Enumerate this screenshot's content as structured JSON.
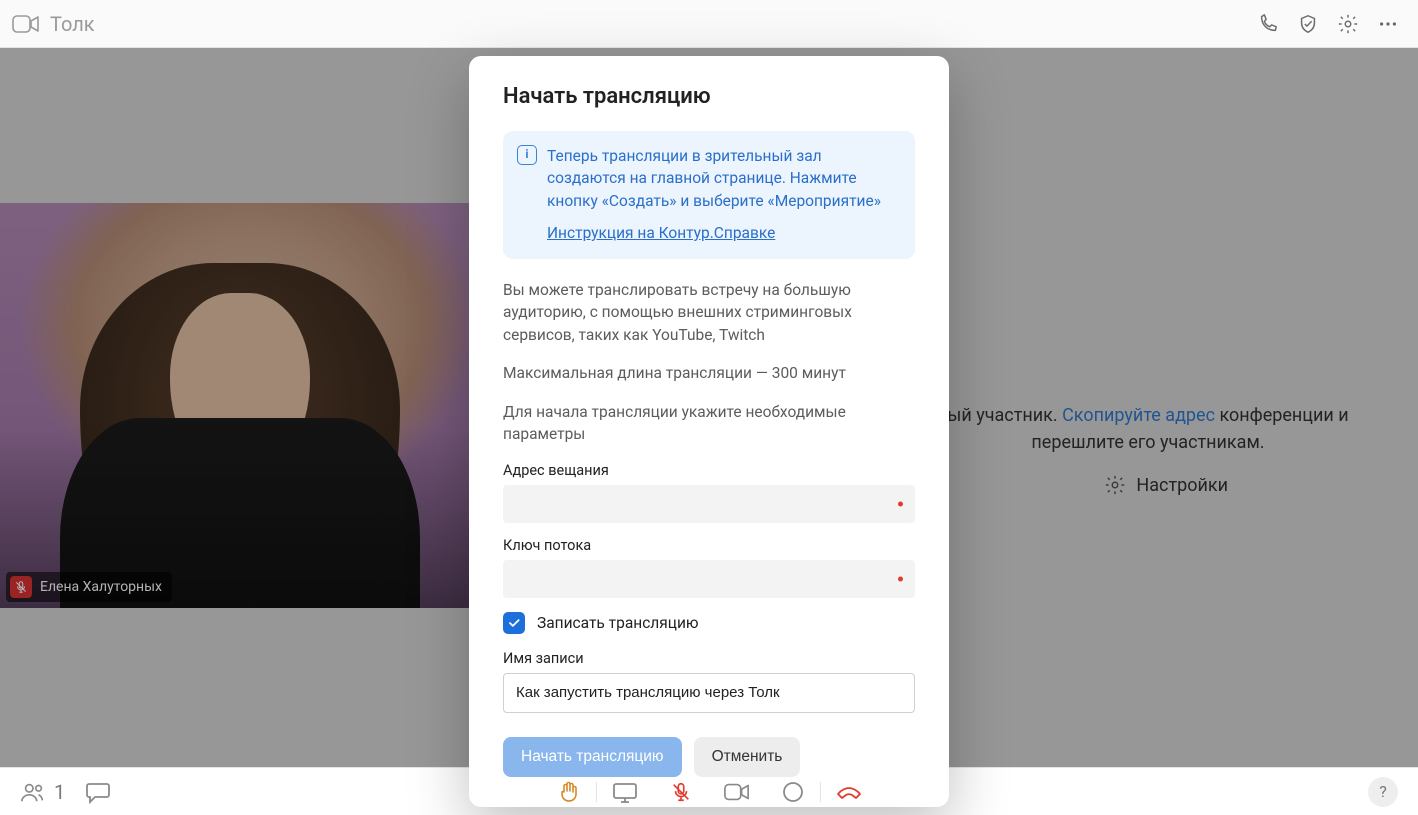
{
  "topbar": {
    "app_name": "Толк"
  },
  "video": {
    "participant_name": "Елена Халуторных"
  },
  "background": {
    "sentence_part1": "ый участник. ",
    "copy_link_text": "Скопируйте адрес",
    "sentence_part2": " конференции и перешлите его участникам.",
    "settings_label": "Настройки"
  },
  "bottombar": {
    "participant_count": "1"
  },
  "modal": {
    "title": "Начать трансляцию",
    "info_text": "Теперь трансляции в зрительный зал создаются на главной странице. Нажмите кнопку «Создать» и выберите «Мероприятие»",
    "info_link": "Инструкция на Контур.Справке",
    "para1": "Вы можете транслировать встречу на большую аудиторию, с помощью внешних стриминговых сервисов, таких как YouTube, Twitch",
    "para2": "Максимальная длина трансляции — 300 минут",
    "para3": "Для начала трансляции укажите необходимые параметры",
    "label_address": "Адрес вещания",
    "address_value": "",
    "label_key": "Ключ потока",
    "key_value": "",
    "checkbox_label": "Записать трансляцию",
    "checkbox_checked": true,
    "label_recording_name": "Имя записи",
    "recording_name_value": "Как запустить трансляцию через Толк",
    "btn_primary": "Начать трансляцию",
    "btn_secondary": "Отменить"
  }
}
